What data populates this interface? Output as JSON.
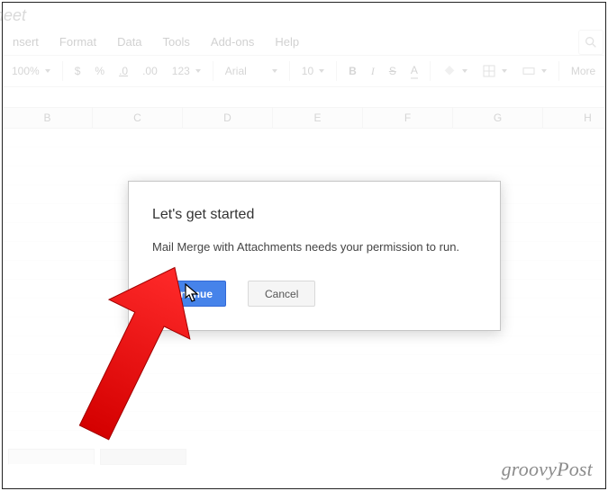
{
  "doc": {
    "title_fragment": "sheet"
  },
  "menu": {
    "items": [
      "nsert",
      "Format",
      "Data",
      "Tools",
      "Add-ons",
      "Help"
    ]
  },
  "toolbar": {
    "zoom": "100%",
    "currency": "$",
    "percent": "%",
    "dec_less": ".0",
    "dec_more": ".00",
    "numfmt": "123",
    "font": "Arial",
    "fontsize": "10",
    "bold": "B",
    "italic": "I",
    "strike": "S",
    "textcolor": "A",
    "more": "More"
  },
  "columns": [
    "B",
    "C",
    "D",
    "E",
    "F",
    "G",
    "H"
  ],
  "dialog": {
    "title": "Let's get started",
    "body": "Mail Merge with Attachments needs your permission to run.",
    "continue": "Continue",
    "cancel": "Cancel"
  },
  "watermark": "groovyPost"
}
